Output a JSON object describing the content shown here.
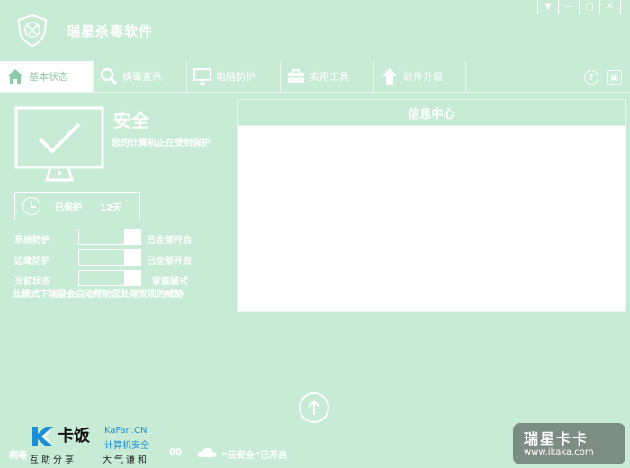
{
  "app": {
    "title": "瑞星杀毒软件"
  },
  "window_controls": [
    "▼",
    "—",
    "□",
    "✕"
  ],
  "tabs": [
    {
      "label": "基本状态",
      "icon": "home-icon",
      "active": true
    },
    {
      "label": "病毒查杀",
      "icon": "magnifier-icon",
      "active": false
    },
    {
      "label": "电脑防护",
      "icon": "monitor-icon",
      "active": false
    },
    {
      "label": "实用工具",
      "icon": "toolbox-icon",
      "active": false
    },
    {
      "label": "软件升级",
      "icon": "arrow-up-icon",
      "active": false
    }
  ],
  "top_right": {
    "help": "?",
    "menu": "▣"
  },
  "status": {
    "title": "安全",
    "description": "您的计算机正在受到保护",
    "protected_label": "已保护",
    "protected_days": "12天"
  },
  "protection_rows": [
    {
      "label": "系统防护",
      "status": "已全部开启"
    },
    {
      "label": "边缘防护",
      "status": "已全部开启"
    },
    {
      "label": "当前状态",
      "status": "家庭模式"
    }
  ],
  "note": "此模式下瑞星会自动帮助您处理发现的威胁",
  "info_center": {
    "title": "信息中心"
  },
  "bottom": {
    "left_text": "病毒",
    "time_text": "00",
    "cloud_text": "“云安全”已开启"
  },
  "watermark_kafan": {
    "name_cn": "卡饭",
    "name_en": "KaFan.CN",
    "tagline": "计算机安全",
    "sub1": "互助分享",
    "sub2": "大气谦和"
  },
  "watermark_ikaka": {
    "name_cn": "瑞星卡卡",
    "url": "www.ikaka.com"
  },
  "colors": {
    "background": "#c8ebd5",
    "panel": "#ffffff",
    "accent_text": "#8fcaa8"
  }
}
